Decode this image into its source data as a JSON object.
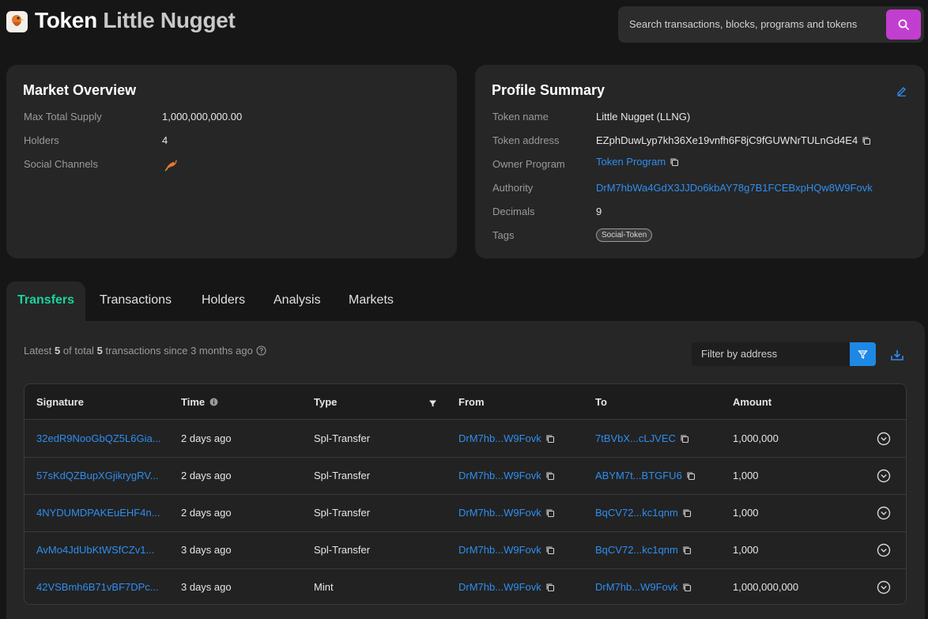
{
  "header": {
    "title_prefix": "Token",
    "title_name": "Little Nugget",
    "search_placeholder": "Search transactions, blocks, programs and tokens"
  },
  "market": {
    "title": "Market Overview",
    "max_supply_label": "Max Total Supply",
    "max_supply_value": "1,000,000,000.00",
    "holders_label": "Holders",
    "holders_value": "4",
    "social_label": "Social Channels"
  },
  "profile": {
    "title": "Profile Summary",
    "name_label": "Token name",
    "name_value": "Little Nugget (LLNG)",
    "address_label": "Token address",
    "address_value": "EZphDuwLyp7kh36Xe19vnfh6F8jC9fGUWNrTULnGd4E4",
    "owner_label": "Owner Program",
    "owner_value": "Token Program",
    "authority_label": "Authority",
    "authority_value": "DrM7hbWa4GdX3JJDo6kbAY78g7B1FCEBxpHQw8W9Fovk",
    "decimals_label": "Decimals",
    "decimals_value": "9",
    "tags_label": "Tags",
    "tag_value": "Social-Token"
  },
  "tabs": [
    "Transfers",
    "Transactions",
    "Holders",
    "Analysis",
    "Markets"
  ],
  "summary": {
    "prefix": "Latest",
    "shown": "5",
    "middle": "of total",
    "total": "5",
    "suffix": "transactions since 3 months ago"
  },
  "filter": {
    "placeholder": "Filter by address"
  },
  "table": {
    "headers": [
      "Signature",
      "Time",
      "Type",
      "From",
      "To",
      "Amount"
    ],
    "rows": [
      {
        "signature": "32edR9NooGbQZ5L6Gia...",
        "time": "2 days ago",
        "type": "Spl-Transfer",
        "from": "DrM7hb...W9Fovk",
        "to": "7tBVbX...cLJVEC",
        "amount": "1,000,000"
      },
      {
        "signature": "57sKdQZBupXGjikrygRV...",
        "time": "2 days ago",
        "type": "Spl-Transfer",
        "from": "DrM7hb...W9Fovk",
        "to": "ABYM7t...BTGFU6",
        "amount": "1,000"
      },
      {
        "signature": "4NYDUMDPAKEuEHF4n...",
        "time": "2 days ago",
        "type": "Spl-Transfer",
        "from": "DrM7hb...W9Fovk",
        "to": "BqCV72...kc1qnm",
        "amount": "1,000"
      },
      {
        "signature": "AvMo4JdUbKtWSfCZv1...",
        "time": "3 days ago",
        "type": "Spl-Transfer",
        "from": "DrM7hb...W9Fovk",
        "to": "BqCV72...kc1qnm",
        "amount": "1,000"
      },
      {
        "signature": "42VSBmh6B71vBF7DPc...",
        "time": "3 days ago",
        "type": "Mint",
        "from": "DrM7hb...W9Fovk",
        "to": "DrM7hb...W9Fovk",
        "amount": "1,000,000,000"
      }
    ]
  },
  "colors": {
    "accent_active_tab": "#19d49c",
    "link": "#2e8ef0",
    "search_button": "#c23ed0",
    "filter_button": "#1e88e5"
  },
  "icons": [
    "token-logo-icon",
    "search-icon",
    "bird-icon",
    "copy-icon",
    "edit-icon",
    "help-icon",
    "filter-icon",
    "download-icon",
    "info-icon",
    "expand-icon"
  ]
}
